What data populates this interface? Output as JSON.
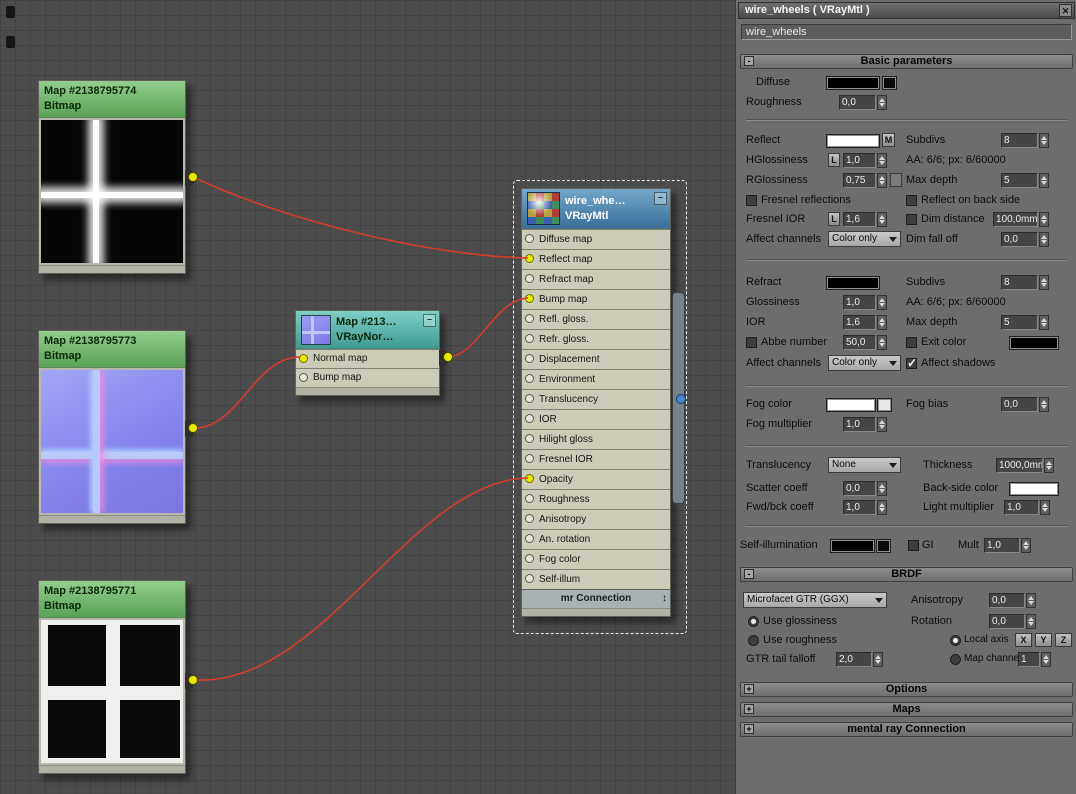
{
  "colors": {
    "wire": "#d63a2b",
    "connector_yellow": "#e9e600",
    "output_blue": "#4a86c8",
    "bitmap_header_green": "#6fae6f",
    "normalmap_header_teal": "#4fa89e",
    "material_header_blue": "#4c83ab",
    "diffuse_swatch": "#000000",
    "reflect_swatch": "#ffffff",
    "refract_swatch": "#000000",
    "exit_color_swatch": "#000000",
    "fog_color_swatch": "#ffffff",
    "back_side_swatch": "#ffffff",
    "self_illumination_swatch": "#000000"
  },
  "canvas": {
    "nodes": {
      "bitmap_top": {
        "title": "Map #2138795774",
        "subtitle": "Bitmap"
      },
      "bitmap_middle": {
        "title": "Map #2138795773",
        "subtitle": "Bitmap"
      },
      "bitmap_bottom": {
        "title": "Map #2138795771",
        "subtitle": "Bitmap"
      },
      "normal_map": {
        "title": "Map #213…",
        "subtitle": "VRayNor…",
        "collapse_glyph": "–",
        "slots": [
          {
            "label": "Normal map"
          },
          {
            "label": "Bump map"
          }
        ]
      },
      "material": {
        "title": "wire_whe…",
        "subtitle": "VRayMtl",
        "collapse_glyph": "–",
        "footer": "mr Connection",
        "footer_scroll_glyph": "↕",
        "slots": [
          {
            "label": "Diffuse map"
          },
          {
            "label": "Reflect map"
          },
          {
            "label": "Refract map"
          },
          {
            "label": "Bump map"
          },
          {
            "label": "Refl. gloss."
          },
          {
            "label": "Refr. gloss."
          },
          {
            "label": "Displacement"
          },
          {
            "label": "Environment"
          },
          {
            "label": "Translucency"
          },
          {
            "label": "IOR"
          },
          {
            "label": "Hilight gloss"
          },
          {
            "label": "Fresnel IOR"
          },
          {
            "label": "Opacity"
          },
          {
            "label": "Roughness"
          },
          {
            "label": "Anisotropy"
          },
          {
            "label": "An. rotation"
          },
          {
            "label": "Fog color"
          },
          {
            "label": "Self-illum"
          }
        ]
      }
    }
  },
  "panel": {
    "title": "wire_wheels ( VRayMtl )",
    "close_glyph": "✕",
    "name_value": "wire_wheels",
    "rollouts": {
      "basic": {
        "state": "-",
        "title": "Basic parameters"
      },
      "brdf": {
        "state": "-",
        "title": "BRDF"
      },
      "options": {
        "state": "+",
        "title": "Options"
      },
      "maps": {
        "state": "+",
        "title": "Maps"
      },
      "mental_ray": {
        "state": "+",
        "title": "mental ray Connection"
      }
    },
    "basic": {
      "diffuse_label": "Diffuse",
      "roughness_label": "Roughness",
      "roughness_value": "0,0",
      "reflect_label": "Reflect",
      "reflect_map_button": "M",
      "subdivs_reflect_label": "Subdivs",
      "subdivs_reflect_value": "8",
      "hglossiness_label": "HGlossiness",
      "hglossiness_lock": "L",
      "hglossiness_value": "1,0",
      "aa_reflect": "AA: 6/6; px: 6/60000",
      "rglossiness_label": "RGlossiness",
      "rglossiness_value": "0,75",
      "max_depth_reflect_label": "Max depth",
      "max_depth_reflect_value": "5",
      "fresnel_reflections_label": "Fresnel reflections",
      "reflect_on_back_label": "Reflect on back side",
      "fresnel_ior_label": "Fresnel IOR",
      "fresnel_ior_lock": "L",
      "fresnel_ior_value": "1,6",
      "dim_distance_label": "Dim distance",
      "dim_distance_value": "100,0mm",
      "affect_channels_reflect_label": "Affect channels",
      "affect_channels_reflect_value": "Color only",
      "dim_fall_off_label": "Dim fall off",
      "dim_fall_off_value": "0,0",
      "refract_label": "Refract",
      "subdivs_refract_label": "Subdivs",
      "subdivs_refract_value": "8",
      "glossiness_label": "Glossiness",
      "glossiness_value": "1,0",
      "aa_refract": "AA: 6/6; px: 6/60000",
      "ior_label": "IOR",
      "ior_value": "1,6",
      "max_depth_refract_label": "Max depth",
      "max_depth_refract_value": "5",
      "abbe_number_label": "Abbe number",
      "abbe_number_value": "50,0",
      "exit_color_label": "Exit color",
      "affect_channels_refract_label": "Affect channels",
      "affect_channels_refract_value": "Color only",
      "affect_shadows_label": "Affect shadows",
      "fog_color_label": "Fog color",
      "fog_bias_label": "Fog bias",
      "fog_bias_value": "0,0",
      "fog_multiplier_label": "Fog multiplier",
      "fog_multiplier_value": "1,0",
      "translucency_label": "Translucency",
      "translucency_value": "None",
      "thickness_label": "Thickness",
      "thickness_value": "1000,0mm",
      "scatter_coeff_label": "Scatter coeff",
      "scatter_coeff_value": "0,0",
      "back_side_color_label": "Back-side color",
      "fwd_bck_coeff_label": "Fwd/bck coeff",
      "fwd_bck_coeff_value": "1,0",
      "light_multiplier_label": "Light multiplier",
      "light_multiplier_value": "1,0",
      "self_illumination_label": "Self-illumination",
      "gi_label": "GI",
      "mult_label": "Mult",
      "mult_value": "1,0"
    },
    "brdf": {
      "type_value": "Microfacet GTR (GGX)",
      "anisotropy_label": "Anisotropy",
      "anisotropy_value": "0,0",
      "use_glossiness_label": "Use glossiness",
      "rotation_label": "Rotation",
      "rotation_value": "0,0",
      "use_roughness_label": "Use roughness",
      "local_axis_label": "Local axis",
      "axis_x": "X",
      "axis_y": "Y",
      "axis_z": "Z",
      "gtr_tail_falloff_label": "GTR tail falloff",
      "gtr_tail_falloff_value": "2,0",
      "map_channel_label": "Map channel",
      "map_channel_value": "1"
    }
  }
}
